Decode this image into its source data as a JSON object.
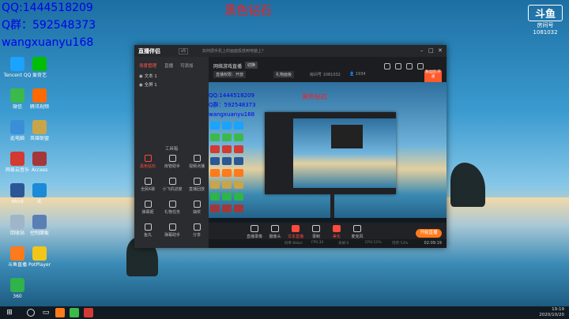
{
  "overlay": {
    "qq_label": "QQ:1444518209",
    "group_label": "Q群：592548373",
    "wechat_label": "wangxuanyu168",
    "title": "黑色钻石"
  },
  "douyu": {
    "logo": "斗鱼",
    "sub": "房间号",
    "room_number": "1081032"
  },
  "desktop_icons": [
    {
      "label": "Tencent QQ",
      "color": "#1aa3ff"
    },
    {
      "label": "微信",
      "color": "#3cb94b"
    },
    {
      "label": "此电脑",
      "color": "#3b8fd6"
    },
    {
      "label": "网易云音乐",
      "color": "#d33a31"
    },
    {
      "label": "Word",
      "color": "#2b5797"
    },
    {
      "label": "回收站",
      "color": "#9fb6c9"
    },
    {
      "label": "斗鱼直播",
      "color": "#ff7a1a"
    },
    {
      "label": "360",
      "color": "#2fb34a"
    },
    {
      "label": "爱奇艺",
      "color": "#00be06"
    },
    {
      "label": "腾讯视频",
      "color": "#ff6a00"
    },
    {
      "label": "英雄联盟",
      "color": "#c8a54b"
    },
    {
      "label": "Access",
      "color": "#a4373a"
    },
    {
      "label": "IE",
      "color": "#1b8ad8"
    },
    {
      "label": "控制面板",
      "color": "#5a7fb5"
    },
    {
      "label": "PotPlayer",
      "color": "#f2c618"
    }
  ],
  "app": {
    "logo": "直播伴侣",
    "version": "v5",
    "notice": "如何把手机上的画面投放到电脑上？",
    "side_tabs": [
      "场景管理",
      "直播",
      "可添加"
    ],
    "scenes": [
      "文本 1",
      "全屏 1"
    ],
    "tools_title": "工具箱",
    "tools": [
      {
        "label": "黑色钻石",
        "red": true
      },
      {
        "label": "房管助手",
        "red": false
      },
      {
        "label": "视频点播",
        "red": false
      },
      {
        "label": "全民K歌",
        "red": false
      },
      {
        "label": "小飞机进度",
        "red": false
      },
      {
        "label": "直播回放",
        "red": false
      },
      {
        "label": "弹幕姬",
        "red": false
      },
      {
        "label": "礼物任务",
        "red": false
      },
      {
        "label": "抽奖",
        "red": false
      },
      {
        "label": "鱼丸",
        "red": false
      },
      {
        "label": "弹幕助手",
        "red": false
      },
      {
        "label": "分享",
        "red": false
      }
    ],
    "room": {
      "title": "网络游戏直播",
      "tag": "切换",
      "chips": [
        "直播权限：开放",
        "礼物面板"
      ],
      "room_id": "房间号 1081032",
      "viewers": "1934"
    },
    "fans_badge": "粉丝团 开通",
    "preview": {
      "qq_label": "QQ:1444518209",
      "group_label": "Q群：592548373",
      "wechat_label": "wangxuanyu168",
      "title": "黑色钻石"
    },
    "controls": [
      {
        "label": "直播录像",
        "red": false
      },
      {
        "label": "摄像头",
        "red": false
      },
      {
        "label": "文本直播",
        "red": true
      },
      {
        "label": "录制",
        "red": false
      },
      {
        "label": "美化",
        "red": true
      },
      {
        "label": "麦克风",
        "red": false
      }
    ],
    "go_live": "开始直播",
    "stats": [
      "码率:0kb/s",
      "FPS:30",
      "丢帧:0",
      "CPU:11%",
      "内存:53%"
    ],
    "timer": "02:09:19"
  },
  "taskbar": {
    "clock": "19:19",
    "date": "2020/10/20"
  }
}
